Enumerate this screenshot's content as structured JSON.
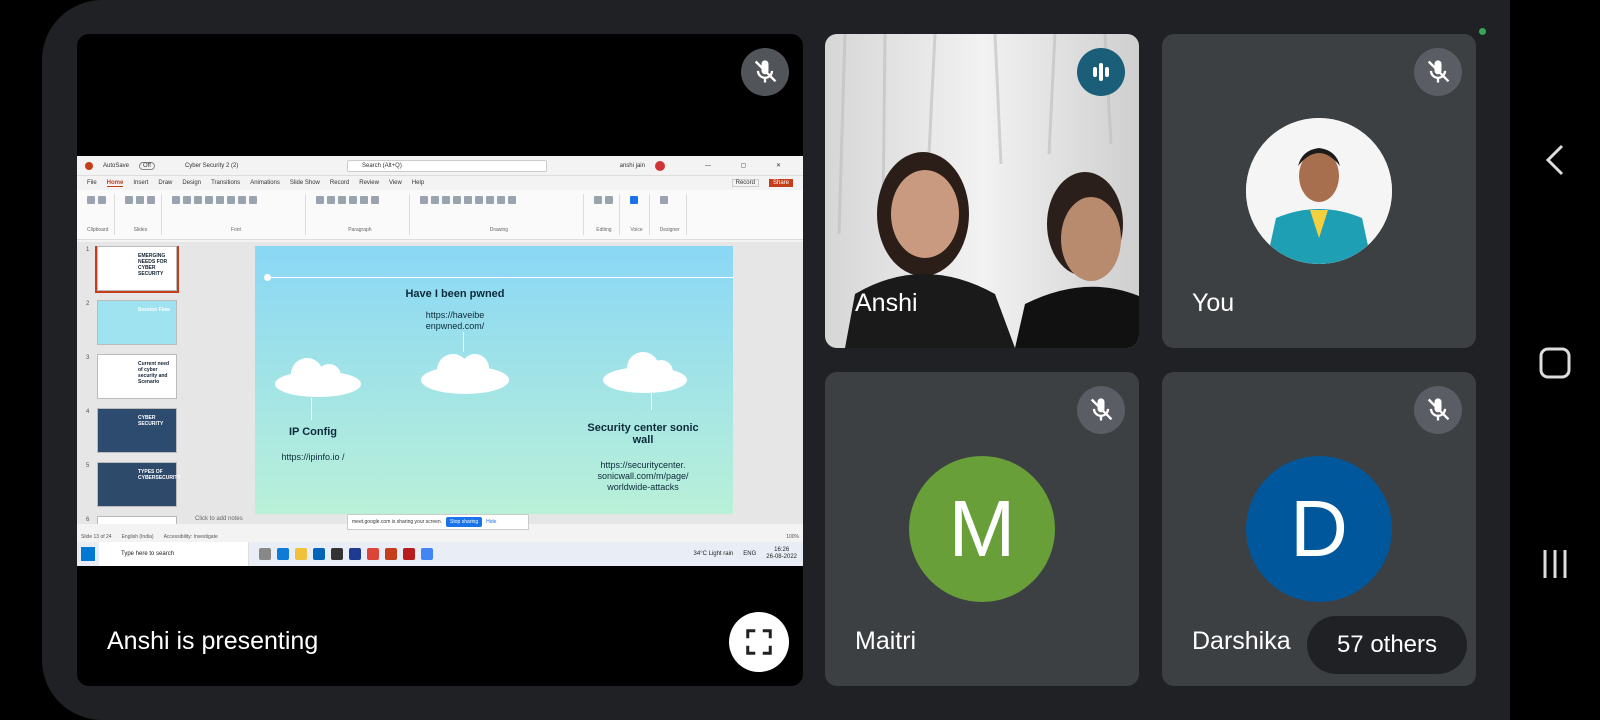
{
  "presentation": {
    "presenting_label": "Anshi is presenting",
    "ppt": {
      "autosave": "AutoSave",
      "autosave_state": "Off",
      "doc_title": "Cyber Security 2 (2)",
      "search_placeholder": "Search (Alt+Q)",
      "user": "anshi jain",
      "menu": [
        "File",
        "Home",
        "Insert",
        "Draw",
        "Design",
        "Transitions",
        "Animations",
        "Slide Show",
        "Record",
        "Review",
        "View",
        "Help"
      ],
      "active_menu": "Home",
      "record": "Record",
      "share": "Share",
      "ribbon_groups": [
        "Clipboard",
        "Slides",
        "Font",
        "Paragraph",
        "Drawing",
        "Editing",
        "Voice",
        "Designer"
      ],
      "thumbnails": [
        {
          "n": "1",
          "text": "EMERGING NEEDS FOR CYBER SECURITY",
          "bg": "#ffffff"
        },
        {
          "n": "2",
          "text": "Session Flow",
          "bg": "#9fe3f0"
        },
        {
          "n": "3",
          "text": "Current need of cyber security and Scenario",
          "bg": "#ffffff"
        },
        {
          "n": "4",
          "text": "CYBER SECURITY",
          "bg": "#2c4b6e"
        },
        {
          "n": "5",
          "text": "TYPES OF CYBERSECURITY",
          "bg": "#2e4a6b"
        },
        {
          "n": "6",
          "text": "",
          "bg": "#ffffff"
        }
      ],
      "slide": {
        "heading_center": "Have I been pwned",
        "url_center": "https://haveibe enpwned.com/",
        "heading_left": "IP Config",
        "url_left": "https://ipinfo.io /",
        "heading_right": "Security center sonic wall",
        "url_right": "https://securitycenter. sonicwall.com/m/page/ worldwide-attacks"
      },
      "notes": "Click to add notes",
      "share_notice": "meet.google.com is sharing your screen.",
      "stop_sharing": "Stop sharing",
      "hide": "Hide",
      "status_slide": "Slide 13 of 24",
      "status_lang": "English (India)",
      "status_access": "Accessibility: Investigate",
      "zoom": "100%",
      "taskbar_search": "Type here to search",
      "weather": "34°C Light rain",
      "lang": "ENG",
      "time": "16:26",
      "date": "26-08-2022"
    }
  },
  "participants": [
    {
      "name": "Anshi"
    },
    {
      "name": "You"
    },
    {
      "name": "Maitri",
      "initial": "M",
      "color": "#689f38"
    },
    {
      "name": "Darshika",
      "initial": "D",
      "color": "#01579b"
    }
  ],
  "others_label": "57 others",
  "colors": {
    "tile_bg": "#3c4043",
    "panel_bg": "#202124",
    "speaking": "#1a5e7a",
    "record_dot": "#34a853"
  }
}
